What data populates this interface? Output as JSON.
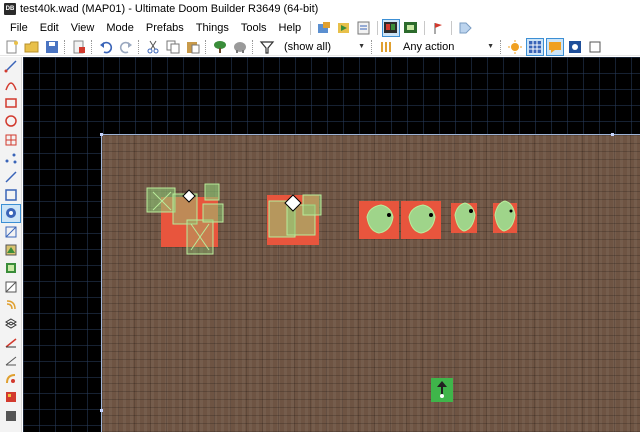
{
  "window": {
    "app_icon": "DB",
    "title": "test40k.wad (MAP01) - Ultimate Doom Builder R3649 (64-bit)"
  },
  "menu": {
    "items": [
      "File",
      "Edit",
      "View",
      "Mode",
      "Prefabs",
      "Things",
      "Tools",
      "Help"
    ]
  },
  "toolbar": {
    "filter_value": "(show all)",
    "action_value": "Any action"
  },
  "icons": {
    "menubar": [
      "test-map-icon",
      "test-map-from-view-icon",
      "script-editor-icon",
      "toggle-3d-icon",
      "game-config-icon",
      "tag-explorer-icon"
    ],
    "toolbar": [
      "new-map-icon",
      "open-map-icon",
      "save-map-icon",
      "map-options-icon",
      "undo-icon",
      "redo-icon",
      "cut-icon",
      "copy-icon",
      "paste-icon",
      "insert-prefab-icon",
      "prefab-icon",
      "filter-icon",
      "linedef-action-icon",
      "brightness-icon",
      "grid-icon",
      "comment-icon",
      "zoom-icon",
      "checkbox-icon"
    ],
    "leftbar": [
      "draw-lines-icon",
      "draw-curve-icon",
      "draw-rectangle-icon",
      "draw-ellipse-icon",
      "draw-grid-icon",
      "vertices-mode-icon",
      "linedefs-mode-icon",
      "sectors-mode-icon",
      "things-mode-icon",
      "visual-mode-icon",
      "make-sectors-icon",
      "sound-propagation-icon",
      "sound-environment-icon",
      "floor-slope-icon",
      "ceiling-height-icon",
      "layers-icon",
      "line-angle-icon",
      "slope-icon",
      "texture-alignment-icon",
      "sector-color-icon"
    ]
  },
  "colors": {
    "map_background": "#000000",
    "sector_floor": "#6e5443",
    "thing_marker": "#e8553d",
    "sprite_outline": "#9fd48a",
    "player_start": "#3fb54a",
    "selection_highlight": "#cce4f7"
  }
}
